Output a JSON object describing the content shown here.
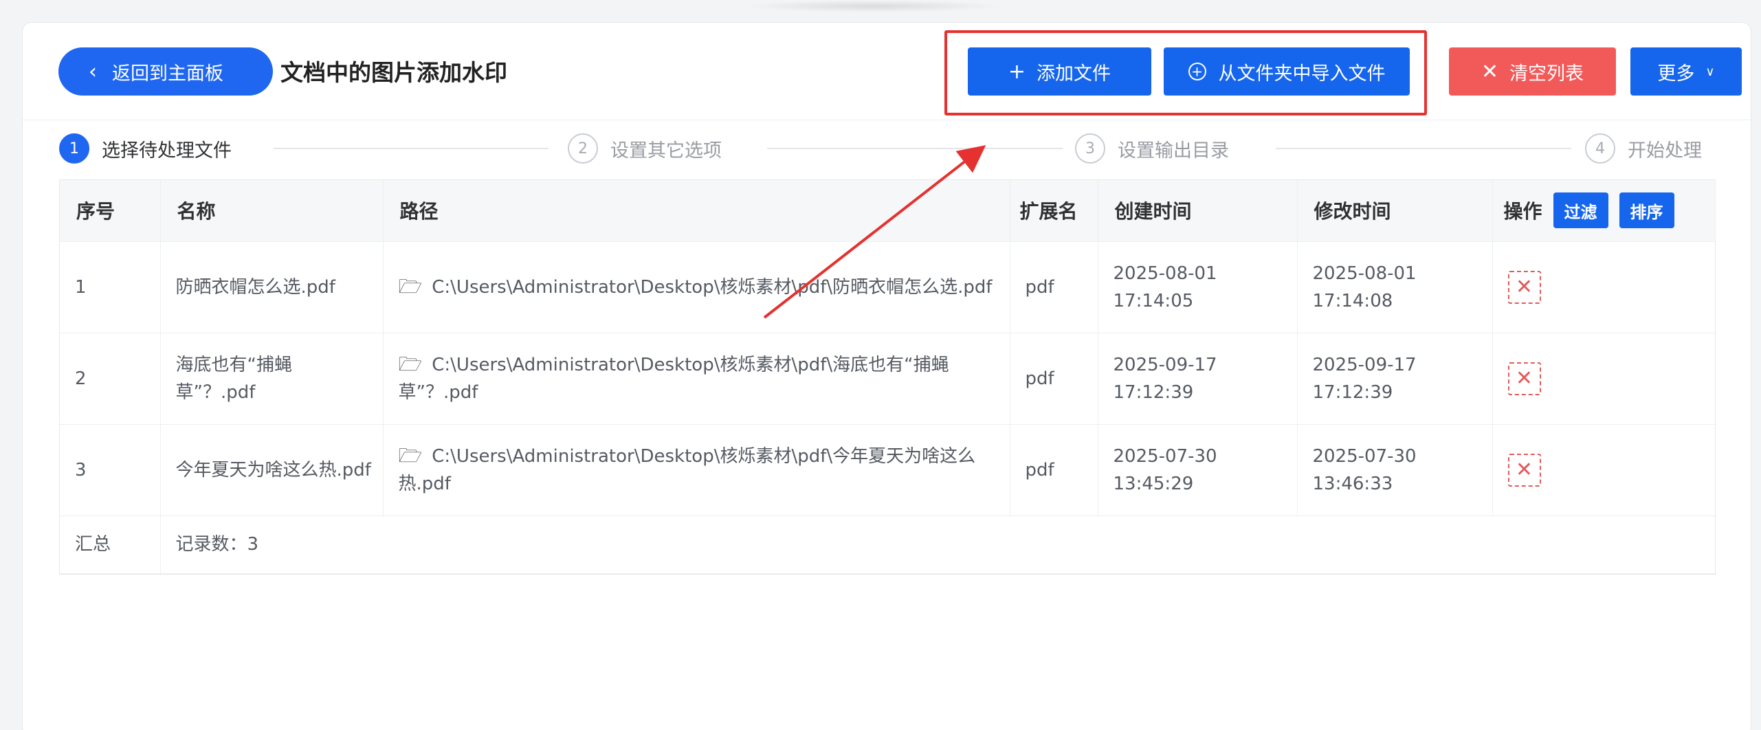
{
  "header": {
    "back_label": "返回到主面板",
    "title": "文档中的图片添加水印",
    "add_file_label": "添加文件",
    "import_folder_label": "从文件夹中导入文件",
    "clear_list_label": "清空列表",
    "more_label": "更多"
  },
  "steps": [
    {
      "num": "1",
      "label": "选择待处理文件"
    },
    {
      "num": "2",
      "label": "设置其它选项"
    },
    {
      "num": "3",
      "label": "设置输出目录"
    },
    {
      "num": "4",
      "label": "开始处理"
    }
  ],
  "table": {
    "headers": {
      "index": "序号",
      "name": "名称",
      "path": "路径",
      "ext": "扩展名",
      "created": "创建时间",
      "modified": "修改时间",
      "ops": "操作",
      "filter_label": "过滤",
      "sort_label": "排序"
    },
    "rows": [
      {
        "index": "1",
        "name": "防晒衣帽怎么选.pdf",
        "path": "C:\\Users\\Administrator\\Desktop\\核烁素材\\pdf\\防晒衣帽怎么选.pdf",
        "ext": "pdf",
        "created": "2025-08-01 17:14:05",
        "modified": "2025-08-01 17:14:08"
      },
      {
        "index": "2",
        "name": "海底也有“捕蝇草”？.pdf",
        "path": "C:\\Users\\Administrator\\Desktop\\核烁素材\\pdf\\海底也有“捕蝇草”？.pdf",
        "ext": "pdf",
        "created": "2025-09-17 17:12:39",
        "modified": "2025-09-17 17:12:39"
      },
      {
        "index": "3",
        "name": "今年夏天为啥这么热.pdf",
        "path": "C:\\Users\\Administrator\\Desktop\\核烁素材\\pdf\\今年夏天为啥这么热.pdf",
        "ext": "pdf",
        "created": "2025-07-30 13:45:29",
        "modified": "2025-07-30 13:46:33"
      }
    ],
    "summary": {
      "label": "汇总",
      "count_text": "记录数：3"
    }
  },
  "colors": {
    "primary": "#1565ed",
    "danger": "#f25a5a",
    "highlight": "#e5312f"
  }
}
